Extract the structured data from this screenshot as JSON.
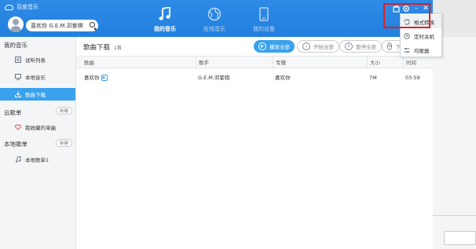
{
  "app": {
    "title": "百度音乐"
  },
  "header": {
    "search_value": "喜欢你 G.E.M.邓紫棋",
    "tabs": [
      {
        "label": "我的音乐",
        "icon": "music-note-icon",
        "active": true
      },
      {
        "label": "在线音乐",
        "icon": "globe-icon",
        "active": false
      },
      {
        "label": "我的设备",
        "icon": "phone-icon",
        "active": false
      }
    ]
  },
  "window_controls": {
    "skin": "skin-icon",
    "settings": "gear-icon",
    "minimize": "–",
    "close": "✕"
  },
  "settings_menu": {
    "items": [
      {
        "label": "格式转换",
        "icon": "convert-icon"
      },
      {
        "label": "定时关机",
        "icon": "timer-icon"
      },
      {
        "label": "均衡器",
        "icon": "equalizer-icon"
      }
    ]
  },
  "sidebar": {
    "my_music": "我的音乐",
    "items": [
      {
        "label": "试听列表",
        "icon": "list-icon"
      },
      {
        "label": "本地音乐",
        "icon": "monitor-icon"
      },
      {
        "label": "歌曲下载",
        "icon": "download-icon",
        "active": true
      }
    ],
    "cloud_title": "云歌单",
    "cloud_new": "新建",
    "cloud_items": [
      {
        "label": "我收藏的单曲",
        "icon": "heart-icon"
      }
    ],
    "local_title": "本地歌单",
    "local_new": "新建",
    "local_items": [
      {
        "label": "本地歌单1",
        "icon": "music-note-icon"
      }
    ]
  },
  "main": {
    "title": "歌曲下载",
    "count": "1首",
    "buttons": {
      "play_all": "播放全部",
      "start_all": "开始全部",
      "pause_all": "暂停全部",
      "settings": "下"
    },
    "columns": [
      "歌曲",
      "歌手",
      "专辑",
      "大小",
      "时间"
    ],
    "rows": [
      {
        "song": "喜欢你",
        "artist": "G.E.M.邓紫棋",
        "album": "喜欢你",
        "size": "7M",
        "duration": "03:59"
      }
    ]
  },
  "colors": {
    "accent": "#3aa1ec",
    "header": "#2a86e3",
    "highlight": "#e02020"
  }
}
